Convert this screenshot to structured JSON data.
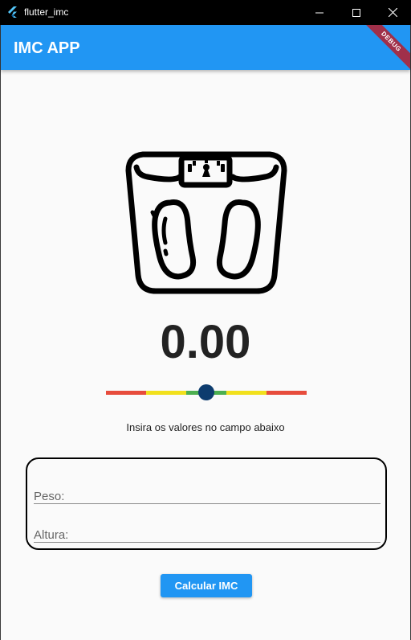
{
  "window": {
    "title": "flutter_imc",
    "controls": [
      "minimize-icon",
      "maximize-icon",
      "close-icon"
    ]
  },
  "appbar": {
    "title": "IMC APP",
    "color": "#2196f3",
    "debug_banner": "DEBUG"
  },
  "illustration": {
    "icon": "bathroom-scale-icon"
  },
  "result": {
    "value": "0.00"
  },
  "gauge": {
    "segments": [
      "#e74c3c",
      "#f1e01c",
      "#4caf50",
      "#f1e01c",
      "#e74c3c"
    ],
    "knob_color": "#0d3c6e",
    "level": 0.5
  },
  "hint": "Insira os valores no campo abaixo",
  "form": {
    "peso_label": "Peso:",
    "altura_label": "Altura:"
  },
  "button": {
    "label": "Calcular IMC"
  }
}
